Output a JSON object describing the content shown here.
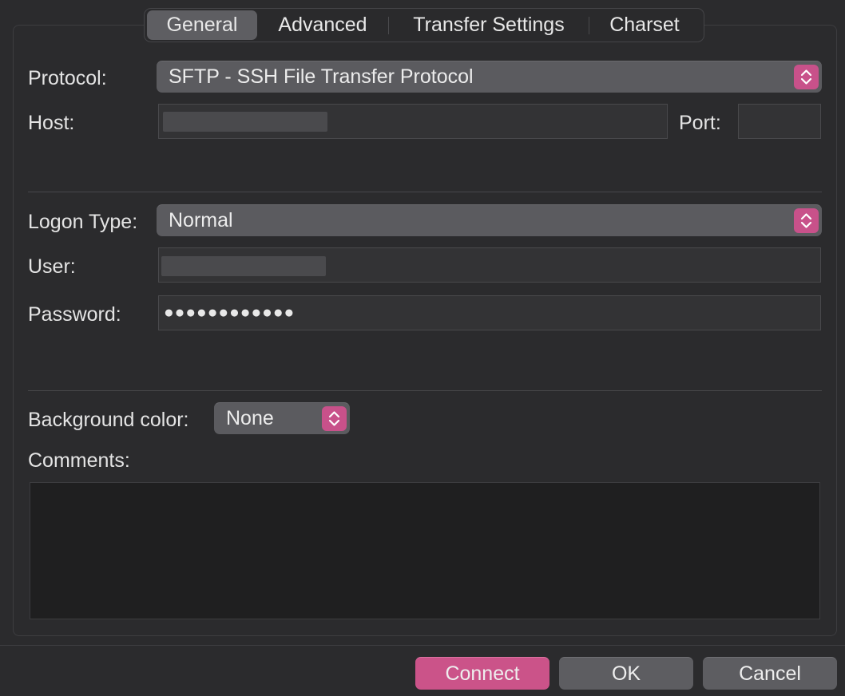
{
  "tabs": [
    {
      "label": "General",
      "active": true
    },
    {
      "label": "Advanced",
      "active": false
    },
    {
      "label": "Transfer Settings",
      "active": false
    },
    {
      "label": "Charset",
      "active": false
    }
  ],
  "form": {
    "protocol_label": "Protocol:",
    "protocol_value": "SFTP - SSH File Transfer Protocol",
    "host_label": "Host:",
    "host_value": "",
    "port_label": "Port:",
    "port_value": "",
    "logon_type_label": "Logon Type:",
    "logon_type_value": "Normal",
    "user_label": "User:",
    "user_value": "",
    "password_label": "Password:",
    "password_value": "●●●●●●●●●●●●",
    "background_color_label": "Background color:",
    "background_color_value": "None",
    "comments_label": "Comments:",
    "comments_value": ""
  },
  "buttons": {
    "connect": "Connect",
    "ok": "OK",
    "cancel": "Cancel"
  },
  "colors": {
    "accent": "#cb5389",
    "background": "#2b2b2d",
    "control": "#5d5d61"
  },
  "icons": {
    "select_stepper": "up-down-chevron-icon"
  }
}
